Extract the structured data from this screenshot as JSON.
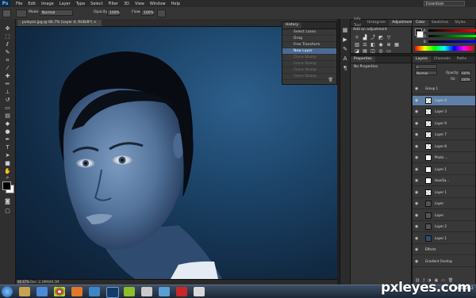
{
  "menubar": {
    "app_icon": "Ps",
    "items": [
      "File",
      "Edit",
      "Image",
      "Layer",
      "Type",
      "Select",
      "Filter",
      "3D",
      "View",
      "Window",
      "Help"
    ],
    "workspace": "Essentials"
  },
  "options": {
    "mode_label": "Mode:",
    "mode_value": "Normal",
    "opacity_label": "Opacity:",
    "opacity_value": "100%",
    "flow_label": "Flow:",
    "flow_value": "100%"
  },
  "document": {
    "tab_title": "pxleyes.jpg @ 66.7% (Layer 4, RGB/8*) ×",
    "zoom": "66.67%",
    "doc_info": "Doc: 2.39M/46.5M"
  },
  "history": {
    "tabs": [
      "History"
    ],
    "rows": [
      {
        "label": "Select Lasso",
        "state": "normal"
      },
      {
        "label": "Drag",
        "state": "normal"
      },
      {
        "label": "Free Transform",
        "state": "normal"
      },
      {
        "label": "New Layer",
        "state": "sel"
      },
      {
        "label": "Clone Stamp",
        "state": "dim"
      },
      {
        "label": "Clone Stamp",
        "state": "dim"
      },
      {
        "label": "Clone Stamp",
        "state": "dim"
      },
      {
        "label": "Clone Stamp",
        "state": "dim"
      }
    ]
  },
  "adjustments": {
    "tabs": [
      "Info Tool",
      "Histogram",
      "Adjustments"
    ],
    "heading": "Add an adjustment"
  },
  "color_panel": {
    "tabs": [
      "Color",
      "Swatches",
      "Styles"
    ],
    "channels": [
      "R",
      "G",
      "B"
    ]
  },
  "properties": {
    "tabs": [
      "Properties"
    ],
    "text": "No Properties"
  },
  "layers": {
    "tabs": [
      "Layers",
      "Channels",
      "Paths"
    ],
    "blend": "Normal",
    "opacity_label": "Opacity:",
    "opacity_value": "100%",
    "fill_label": "Fill:",
    "fill_value": "100%",
    "rows": [
      {
        "name": "Group 1",
        "thumb": "none"
      },
      {
        "name": "Layer 4",
        "thumb": "checker",
        "selected": true
      },
      {
        "name": "Layer 3",
        "thumb": "checker"
      },
      {
        "name": "Layer 9",
        "thumb": "checker"
      },
      {
        "name": "Layer 7",
        "thumb": "checker"
      },
      {
        "name": "Layer 8",
        "thumb": "checker"
      },
      {
        "name": "Photo ...",
        "thumb": "white"
      },
      {
        "name": "Layer 1",
        "thumb": "white"
      },
      {
        "name": "Hue/Sa...",
        "thumb": "white"
      },
      {
        "name": "Layer 1",
        "thumb": "checker"
      },
      {
        "name": "Layer",
        "thumb": "face"
      },
      {
        "name": "Layer",
        "thumb": "face"
      },
      {
        "name": "Layer 2",
        "thumb": "face"
      },
      {
        "name": "Layer 1",
        "thumb": "blue"
      },
      {
        "name": "Effects",
        "thumb": "none"
      },
      {
        "name": "Gradient Overlay",
        "thumb": "none"
      }
    ]
  },
  "watermark": "pxleyes.com",
  "clock": {
    "time": "",
    "date": "09/08/2012"
  },
  "colors": {
    "canvas_bg": "#1c4469",
    "selected_row": "#5f7fa6",
    "skin": "#5a7fa8"
  }
}
